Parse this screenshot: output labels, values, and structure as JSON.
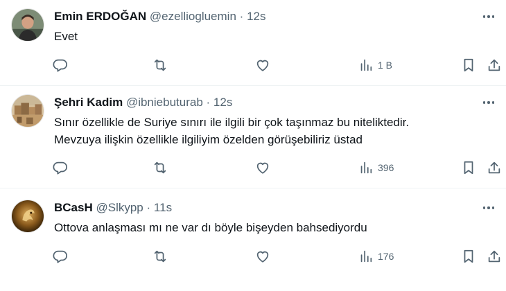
{
  "tweets": [
    {
      "name": "Emin ERDOĞAN",
      "handle": "@ezelliogluemin",
      "sep": "·",
      "time": "12s",
      "text_lines": [
        "Evet"
      ],
      "views": "1 B",
      "avatar_color": "#6a7a6a"
    },
    {
      "name": "Şehri Kadim",
      "handle": "@ibniebuturab",
      "sep": "·",
      "time": "12s",
      "text_lines": [
        "Sınır özellikle de Suriye sınırı ile ilgili bir çok taşınmaz bu niteliktedir.",
        "Mevzuya ilişkin özellikle ilgiliyim özelden görüşebiliriz üstad"
      ],
      "views": "396",
      "avatar_color": "#b08a5a"
    },
    {
      "name": "BCasH",
      "handle": "@Slkypp",
      "sep": "·",
      "time": "11s",
      "text_lines": [
        "Ottova anlaşması mı ne var dı böyle bişeyden bahsediyordu"
      ],
      "views": "176",
      "avatar_color": "#6b4a1c"
    }
  ],
  "icons": {
    "reply": "reply-icon",
    "retweet": "retweet-icon",
    "like": "like-icon",
    "views": "views-icon",
    "bookmark": "bookmark-icon",
    "share": "share-icon",
    "more": "more-icon"
  }
}
